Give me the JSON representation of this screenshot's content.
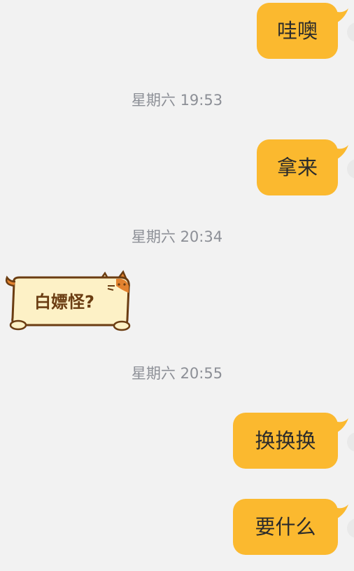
{
  "messages": [
    {
      "type": "outgoing",
      "text": "哇噢"
    },
    {
      "type": "timestamp",
      "text": "星期六 19:53"
    },
    {
      "type": "outgoing",
      "text": "拿来"
    },
    {
      "type": "timestamp",
      "text": "星期六 20:34"
    },
    {
      "type": "sticker",
      "text": "白嫖怪?"
    },
    {
      "type": "timestamp",
      "text": "星期六 20:55"
    },
    {
      "type": "outgoing",
      "text": "换换换"
    },
    {
      "type": "outgoing",
      "text": "要什么"
    }
  ],
  "colors": {
    "background": "#f2f2f2",
    "outgoing_bubble": "#fbb92f",
    "timestamp_text": "#8c8f96",
    "sticker_fill": "#fdf1c6",
    "sticker_outline": "#6b3d12"
  }
}
